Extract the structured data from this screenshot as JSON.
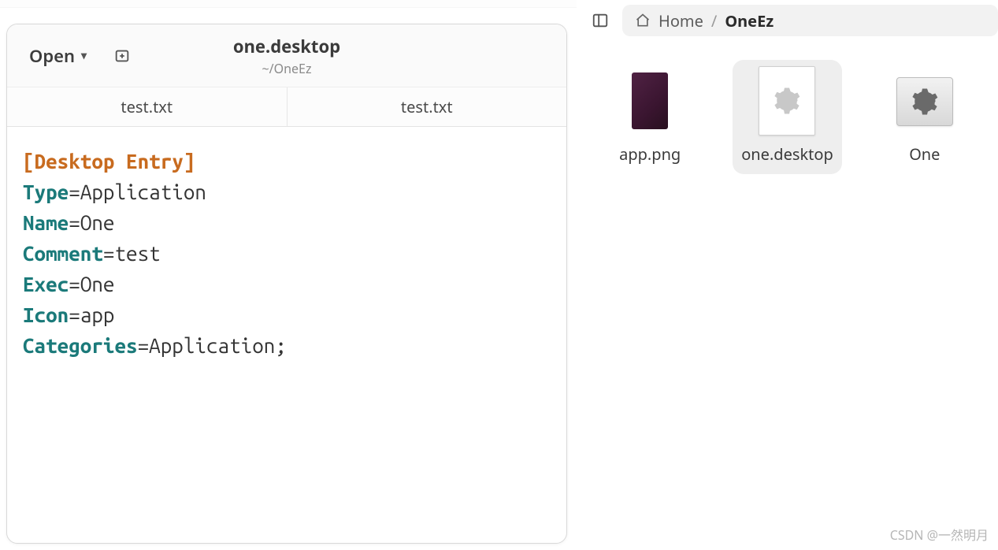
{
  "editor": {
    "open_label": "Open",
    "title": "one.desktop",
    "subtitle": "~/OneEz",
    "tabs": [
      {
        "label": "test.txt"
      },
      {
        "label": "test.txt"
      }
    ],
    "file": {
      "section": "[Desktop Entry]",
      "lines": [
        {
          "key": "Type",
          "value": "Application"
        },
        {
          "key": "Name",
          "value": "One"
        },
        {
          "key": "Comment",
          "value": "test"
        },
        {
          "key": "Exec",
          "value": "One"
        },
        {
          "key": "Icon",
          "value": "app"
        },
        {
          "key": "Categories",
          "value": "Application;"
        }
      ]
    }
  },
  "filemanager": {
    "breadcrumb": {
      "home": "Home",
      "current": "OneEz"
    },
    "items": [
      {
        "name": "app.png",
        "kind": "image",
        "selected": false
      },
      {
        "name": "one.desktop",
        "kind": "desktop",
        "selected": true
      },
      {
        "name": "One",
        "kind": "launcher",
        "selected": false
      }
    ]
  },
  "watermark": "CSDN @一然明月"
}
